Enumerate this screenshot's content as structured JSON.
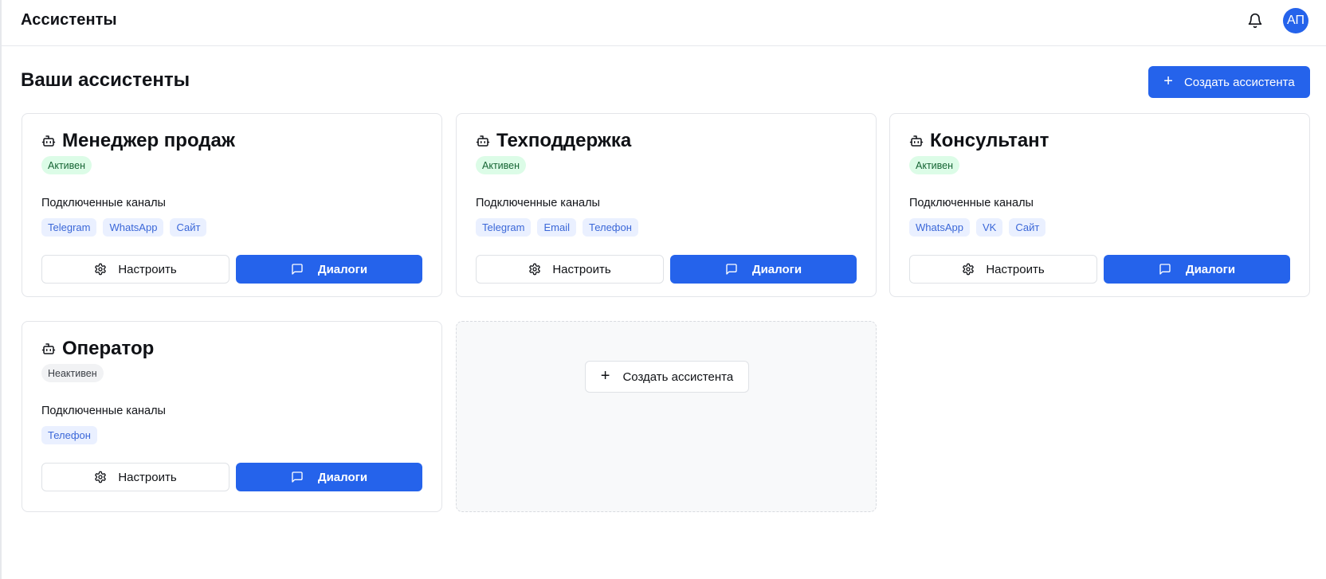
{
  "header": {
    "title": "Ассистенты",
    "notifications_icon": "bell-icon",
    "avatar_initials": "АП"
  },
  "main": {
    "title": "Ваши ассистенты",
    "create_button_label": "Создать ассистента"
  },
  "assistants": [
    {
      "name": "Менеджер продаж",
      "status": "Активен",
      "channels_label": "Подключенные каналы",
      "channels": [
        "Telegram",
        "WhatsApp",
        "Сайт"
      ],
      "configure_label": "Настроить",
      "dialogs_label": "Диалоги"
    },
    {
      "name": "Техподдержка",
      "status": "Активен",
      "channels_label": "Подключенные каналы",
      "channels": [
        "Telegram",
        "Email",
        "Телефон"
      ],
      "configure_label": "Настроить",
      "dialogs_label": "Диалоги"
    },
    {
      "name": "Консультант",
      "status": "Активен",
      "channels_label": "Подключенные каналы",
      "channels": [
        "WhatsApp",
        "VK",
        "Сайт"
      ],
      "configure_label": "Настроить",
      "dialogs_label": "Диалоги"
    },
    {
      "name": "Оператор",
      "status": "Неактивен",
      "channels_label": "Подключенные каналы",
      "channels": [
        "Телефон"
      ],
      "configure_label": "Настроить",
      "dialogs_label": "Диалоги"
    }
  ],
  "create_card": {
    "button_label": "Создать ассистента"
  },
  "colors": {
    "primary": "#2563eb",
    "active_badge_bg": "#dcfce7",
    "active_badge_text": "#166534",
    "chip_bg": "#eaf0ff",
    "chip_text": "#3b67d8"
  }
}
